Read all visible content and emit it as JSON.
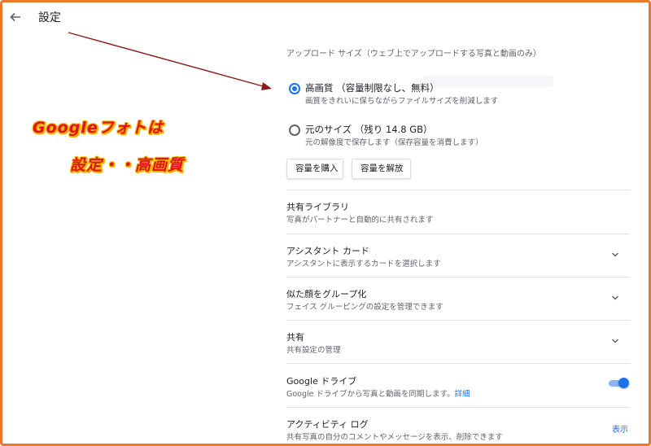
{
  "header": {
    "title": "設定"
  },
  "annotation": {
    "line1": "Googleフォトは",
    "line2": "設定・・高画質"
  },
  "upload_size": {
    "section_label": "アップロード サイズ（ウェブ上でアップロードする写真と動画のみ）",
    "options": [
      {
        "title": "高画質 （容量制限なし、無料）",
        "subtitle": "画質をきれいに保ちながらファイルサイズを削減します",
        "selected": true
      },
      {
        "title": "元のサイズ （残り 14.8 GB）",
        "subtitle": "元の解像度で保存します（保存容量を消費します）",
        "selected": false
      }
    ],
    "buy_label": "容量を購入",
    "free_label": "容量を解放"
  },
  "settings": {
    "shared_library": {
      "title": "共有ライブラリ",
      "subtitle": "写真がパートナーと自動的に共有されます"
    },
    "assistant_cards": {
      "title": "アシスタント カード",
      "subtitle": "アシスタントに表示するカードを選択します"
    },
    "face_grouping": {
      "title": "似た顔をグループ化",
      "subtitle": "フェイス グルーピングの設定を管理できます"
    },
    "sharing": {
      "title": "共有",
      "subtitle": "共有設定の管理"
    },
    "google_drive": {
      "title": "Google ドライブ",
      "subtitle": "Google ドライブから写真と動画を同期します。",
      "link": "詳細",
      "enabled": true
    },
    "activity_log": {
      "title": "アクティビティ ログ",
      "subtitle": "共有写真の自分のコメントやメッセージを表示、削除できます",
      "action": "表示"
    }
  },
  "colors": {
    "accent": "#1a73e8",
    "annotation_text": "#e0141a",
    "annotation_outline": "#f2b400",
    "arrow": "#8b1a1a",
    "frame": "#e87a2c"
  }
}
